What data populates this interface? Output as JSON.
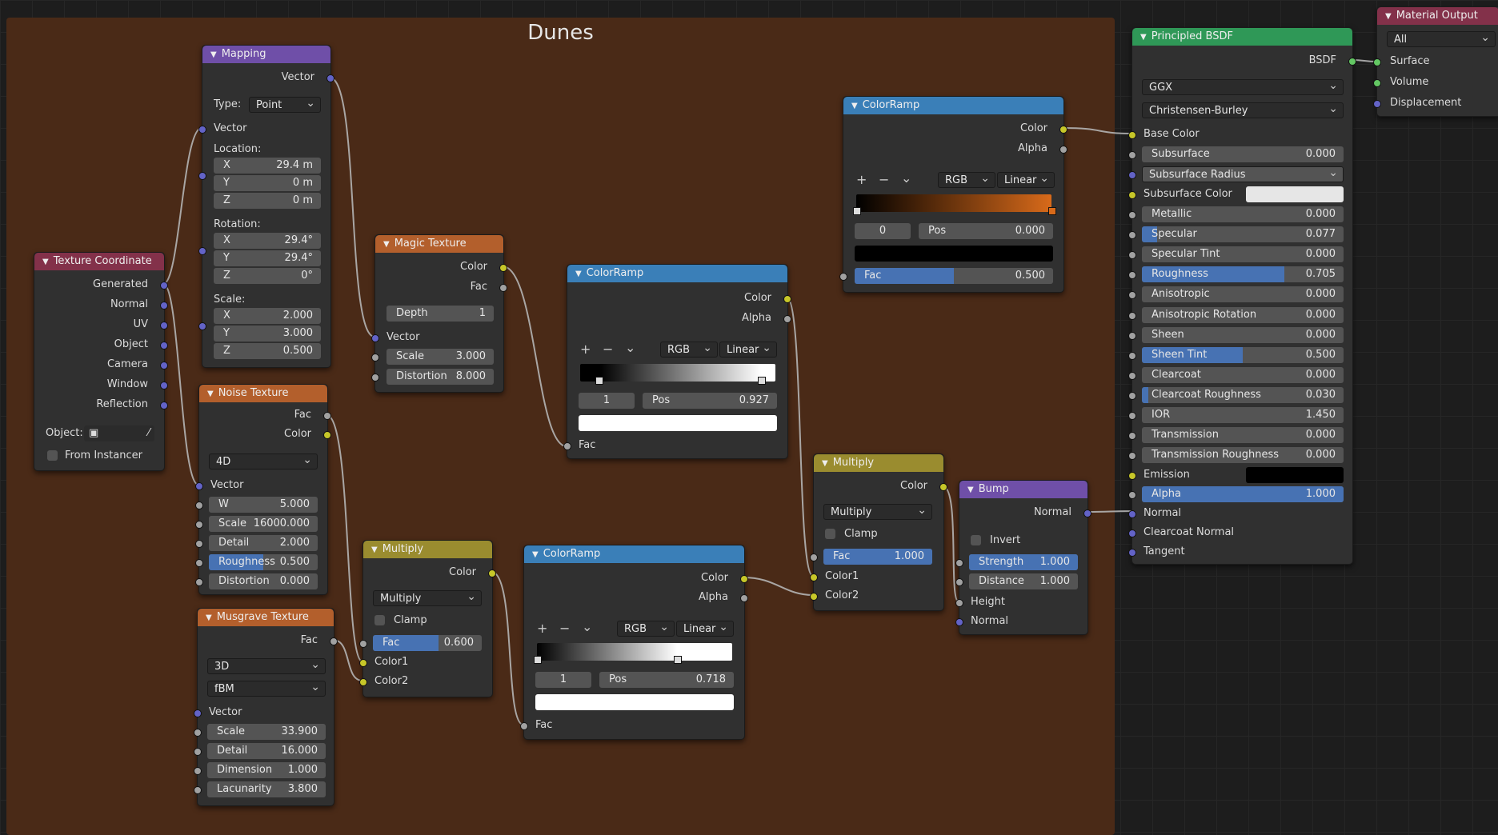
{
  "frame": {
    "title": "Dunes"
  },
  "colors": {
    "frame_bg": "#4a2a17",
    "input_header": "#83314a",
    "vector_header": "#6f4fa8",
    "texture_header": "#b35f2c",
    "converter_header": "#3a7fb8",
    "color_header": "#9a8c2f",
    "shader_header": "#2f9857",
    "slider_fill": "#4772b3"
  },
  "texcoord": {
    "title": "Texture Coordinate",
    "outputs": [
      "Generated",
      "Normal",
      "UV",
      "Object",
      "Camera",
      "Window",
      "Reflection"
    ],
    "object_label": "Object:",
    "from_instancer": "From Instancer"
  },
  "mapping": {
    "title": "Mapping",
    "out_vector": "Vector",
    "type_label": "Type:",
    "type_value": "Point",
    "in_vector": "Vector",
    "location_label": "Location:",
    "loc": [
      {
        "k": "X",
        "v": "29.4 m"
      },
      {
        "k": "Y",
        "v": "0 m"
      },
      {
        "k": "Z",
        "v": "0 m"
      }
    ],
    "rotation_label": "Rotation:",
    "rot": [
      {
        "k": "X",
        "v": "29.4°"
      },
      {
        "k": "Y",
        "v": "29.4°"
      },
      {
        "k": "Z",
        "v": "0°"
      }
    ],
    "scale_label": "Scale:",
    "scale": [
      {
        "k": "X",
        "v": "2.000"
      },
      {
        "k": "Y",
        "v": "3.000"
      },
      {
        "k": "Z",
        "v": "0.500"
      }
    ]
  },
  "noise": {
    "title": "Noise Texture",
    "out_fac": "Fac",
    "out_color": "Color",
    "dim": "4D",
    "in_vector": "Vector",
    "fields": [
      {
        "k": "W",
        "v": "5.000"
      },
      {
        "k": "Scale",
        "v": "16000.000"
      },
      {
        "k": "Detail",
        "v": "2.000"
      },
      {
        "k": "Roughness",
        "v": "0.500",
        "fill": 0.5
      },
      {
        "k": "Distortion",
        "v": "0.000"
      }
    ]
  },
  "musgrave": {
    "title": "Musgrave Texture",
    "out_fac": "Fac",
    "dim": "3D",
    "type": "fBM",
    "in_vector": "Vector",
    "fields": [
      {
        "k": "Scale",
        "v": "33.900"
      },
      {
        "k": "Detail",
        "v": "16.000"
      },
      {
        "k": "Dimension",
        "v": "1.000"
      },
      {
        "k": "Lacunarity",
        "v": "3.800"
      }
    ]
  },
  "magic": {
    "title": "Magic Texture",
    "out_color": "Color",
    "out_fac": "Fac",
    "depth": {
      "k": "Depth",
      "v": "1"
    },
    "in_vector": "Vector",
    "fields": [
      {
        "k": "Scale",
        "v": "3.000"
      },
      {
        "k": "Distortion",
        "v": "8.000"
      }
    ]
  },
  "ramp1": {
    "title": "ColorRamp",
    "out_color": "Color",
    "out_alpha": "Alpha",
    "mode": "RGB",
    "interp": "Linear",
    "index": "1",
    "pos_label": "Pos",
    "pos": "0.927",
    "in_fac": "Fac",
    "stops": [
      0.1,
      0.927
    ]
  },
  "ramp2": {
    "title": "ColorRamp",
    "out_color": "Color",
    "out_alpha": "Alpha",
    "mode": "RGB",
    "interp": "Linear",
    "index": "1",
    "pos_label": "Pos",
    "pos": "0.718",
    "in_fac": "Fac",
    "stops": [
      0.0,
      0.718
    ]
  },
  "ramp3": {
    "title": "ColorRamp",
    "out_color": "Color",
    "out_alpha": "Alpha",
    "mode": "RGB",
    "interp": "Linear",
    "index": "0",
    "pos_label": "Pos",
    "pos": "0.000",
    "fac_label": "Fac",
    "fac": "0.500",
    "fac_fill": 0.5,
    "stops": [
      0.0,
      1.0
    ],
    "ramp_start": "#000000",
    "ramp_end": "#d86a1a"
  },
  "mult1": {
    "title": "Multiply",
    "out_color": "Color",
    "op": "Multiply",
    "clamp": "Clamp",
    "fac_label": "Fac",
    "fac": "0.600",
    "fac_fill": 0.6,
    "in1": "Color1",
    "in2": "Color2"
  },
  "mult2": {
    "title": "Multiply",
    "out_color": "Color",
    "op": "Multiply",
    "clamp": "Clamp",
    "fac_label": "Fac",
    "fac": "1.000",
    "fac_fill": 1.0,
    "in1": "Color1",
    "in2": "Color2"
  },
  "bump": {
    "title": "Bump",
    "out_normal": "Normal",
    "invert": "Invert",
    "fields": [
      {
        "k": "Strength",
        "v": "1.000",
        "fill": 1.0
      },
      {
        "k": "Distance",
        "v": "1.000"
      }
    ],
    "in_height": "Height",
    "in_normal": "Normal"
  },
  "bsdf": {
    "title": "Principled BSDF",
    "out_bsdf": "BSDF",
    "distribution": "GGX",
    "subsurface_method": "Christensen-Burley",
    "base_color": "Base Color",
    "subsurface": {
      "k": "Subsurface",
      "v": "0.000"
    },
    "subsurface_radius": "Subsurface Radius",
    "subsurface_color": "Subsurface Color",
    "fields": [
      {
        "k": "Metallic",
        "v": "0.000",
        "fill": 0
      },
      {
        "k": "Specular",
        "v": "0.077",
        "fill": 0.077
      },
      {
        "k": "Specular Tint",
        "v": "0.000",
        "fill": 0
      },
      {
        "k": "Roughness",
        "v": "0.705",
        "fill": 0.705
      },
      {
        "k": "Anisotropic",
        "v": "0.000",
        "fill": 0
      },
      {
        "k": "Anisotropic Rotation",
        "v": "0.000",
        "fill": 0
      },
      {
        "k": "Sheen",
        "v": "0.000",
        "fill": 0
      },
      {
        "k": "Sheen Tint",
        "v": "0.500",
        "fill": 0.5
      },
      {
        "k": "Clearcoat",
        "v": "0.000",
        "fill": 0
      },
      {
        "k": "Clearcoat Roughness",
        "v": "0.030",
        "fill": 0.03
      },
      {
        "k": "IOR",
        "v": "1.450",
        "fill": 0
      },
      {
        "k": "Transmission",
        "v": "0.000",
        "fill": 0
      },
      {
        "k": "Transmission Roughness",
        "v": "0.000",
        "fill": 0
      }
    ],
    "emission": "Emission",
    "alpha": {
      "k": "Alpha",
      "v": "1.000",
      "fill": 1.0
    },
    "normal": "Normal",
    "clearcoat_normal": "Clearcoat Normal",
    "tangent": "Tangent"
  },
  "output": {
    "title": "Material Output",
    "target": "All",
    "inputs": [
      "Surface",
      "Volume",
      "Displacement"
    ]
  }
}
